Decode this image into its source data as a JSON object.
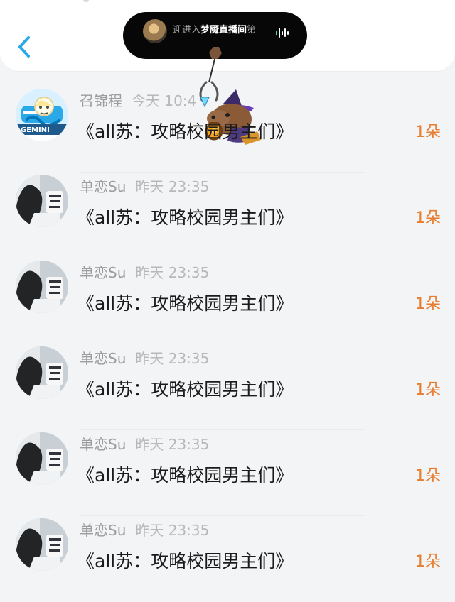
{
  "topbar": {
    "live_notice": {
      "prefix": "迎进入",
      "room": "梦魇直播间",
      "suffix": "第"
    }
  },
  "gift_list": [
    {
      "user": "召锦程",
      "time": "今天 10:4",
      "title": "《all苏：攻略校园男主们》",
      "gift": "1朵",
      "avatar_logo_text": "GEMINI"
    },
    {
      "user": "单恋Su",
      "time": "昨天 23:35",
      "title": "《all苏：攻略校园男主们》",
      "gift": "1朵"
    },
    {
      "user": "单恋Su",
      "time": "昨天 23:35",
      "title": "《all苏：攻略校园男主们》",
      "gift": "1朵"
    },
    {
      "user": "单恋Su",
      "time": "昨天 23:35",
      "title": "《all苏：攻略校园男主们》",
      "gift": "1朵"
    },
    {
      "user": "单恋Su",
      "time": "昨天 23:35",
      "title": "《all苏：攻略校园男主们》",
      "gift": "1朵"
    },
    {
      "user": "单恋Su",
      "time": "昨天 23:35",
      "title": "《all苏：攻略校园男主们》",
      "gift": "1朵"
    }
  ],
  "colors": {
    "accent": "#29a8ea",
    "gift": "#e87d2f",
    "text": "#1b1b1b",
    "meta": "#9c9c9c"
  },
  "icons": {
    "back": "chevron-left-icon",
    "live_wave": "audio-wave-icon",
    "overlay": "capybara-claw-machine-sticker"
  }
}
